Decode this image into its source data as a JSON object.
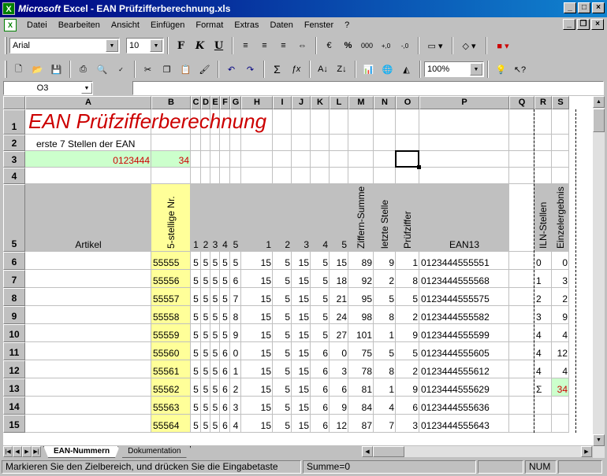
{
  "window": {
    "app_title_italic": "Microsoft",
    "app_title_rest": " Excel - EAN Prüfzifferberechnung.xls"
  },
  "menu": [
    "Datei",
    "Bearbeiten",
    "Ansicht",
    "Einfügen",
    "Format",
    "Extras",
    "Daten",
    "Fenster",
    "?"
  ],
  "toolbar": {
    "font": "Arial",
    "size": "10",
    "bold": "F",
    "italic": "K",
    "underline": "U",
    "zoom": "100%"
  },
  "formula_bar": {
    "name_box": "O3",
    "formula": ""
  },
  "columns": [
    "A",
    "B",
    "C",
    "D",
    "E",
    "F",
    "G",
    "H",
    "I",
    "J",
    "K",
    "L",
    "M",
    "N",
    "O",
    "P",
    "Q",
    "R",
    "S"
  ],
  "rows": [
    "1",
    "2",
    "3",
    "4",
    "5",
    "6",
    "7",
    "8",
    "9",
    "10",
    "11",
    "12",
    "13",
    "14",
    "15"
  ],
  "sheet": {
    "title": "EAN Prüfzifferberechnung",
    "label_first7": "erste 7 Stellen der EAN",
    "ean_prefix": "0123444",
    "result_b3": "34",
    "header": {
      "artikel": "Artikel",
      "nr": "5-stellige Nr.",
      "digit_labels": [
        "1",
        "2",
        "3",
        "4",
        "5"
      ],
      "weighted_labels": [
        "1",
        "2",
        "3",
        "4",
        "5"
      ],
      "ziffern_summe": "Ziffern-Summe",
      "letzte_stelle": "letzte Stelle",
      "pruefziffer": "Prüfziffer",
      "ean13": "EAN13",
      "iln_stellen": "ILN-Stellen",
      "einzelergebnis": "Einzelergebnis"
    },
    "data_rows": [
      {
        "nr": "55555",
        "d": [
          "5",
          "5",
          "5",
          "5",
          "5"
        ],
        "w": [
          "15",
          "5",
          "15",
          "5",
          "15"
        ],
        "sum": "89",
        "last": "9",
        "check": "1",
        "ean": "0123444555551",
        "r": "0",
        "s": "0"
      },
      {
        "nr": "55556",
        "d": [
          "5",
          "5",
          "5",
          "5",
          "6"
        ],
        "w": [
          "15",
          "5",
          "15",
          "5",
          "18"
        ],
        "sum": "92",
        "last": "2",
        "check": "8",
        "ean": "0123444555568",
        "r": "1",
        "s": "3"
      },
      {
        "nr": "55557",
        "d": [
          "5",
          "5",
          "5",
          "5",
          "7"
        ],
        "w": [
          "15",
          "5",
          "15",
          "5",
          "21"
        ],
        "sum": "95",
        "last": "5",
        "check": "5",
        "ean": "0123444555575",
        "r": "2",
        "s": "2"
      },
      {
        "nr": "55558",
        "d": [
          "5",
          "5",
          "5",
          "5",
          "8"
        ],
        "w": [
          "15",
          "5",
          "15",
          "5",
          "24"
        ],
        "sum": "98",
        "last": "8",
        "check": "2",
        "ean": "0123444555582",
        "r": "3",
        "s": "9"
      },
      {
        "nr": "55559",
        "d": [
          "5",
          "5",
          "5",
          "5",
          "9"
        ],
        "w": [
          "15",
          "5",
          "15",
          "5",
          "27"
        ],
        "sum": "101",
        "last": "1",
        "check": "9",
        "ean": "0123444555599",
        "r": "4",
        "s": "4"
      },
      {
        "nr": "55560",
        "d": [
          "5",
          "5",
          "5",
          "6",
          "0"
        ],
        "w": [
          "15",
          "5",
          "15",
          "6",
          "0"
        ],
        "sum": "75",
        "last": "5",
        "check": "5",
        "ean": "0123444555605",
        "r": "4",
        "s": "12"
      },
      {
        "nr": "55561",
        "d": [
          "5",
          "5",
          "5",
          "6",
          "1"
        ],
        "w": [
          "15",
          "5",
          "15",
          "6",
          "3"
        ],
        "sum": "78",
        "last": "8",
        "check": "2",
        "ean": "0123444555612",
        "r": "4",
        "s": "4"
      },
      {
        "nr": "55562",
        "d": [
          "5",
          "5",
          "5",
          "6",
          "2"
        ],
        "w": [
          "15",
          "5",
          "15",
          "6",
          "6"
        ],
        "sum": "81",
        "last": "1",
        "check": "9",
        "ean": "0123444555629",
        "r": "Σ",
        "s": "34"
      },
      {
        "nr": "55563",
        "d": [
          "5",
          "5",
          "5",
          "6",
          "3"
        ],
        "w": [
          "15",
          "5",
          "15",
          "6",
          "9"
        ],
        "sum": "84",
        "last": "4",
        "check": "6",
        "ean": "0123444555636",
        "r": "",
        "s": ""
      },
      {
        "nr": "55564",
        "d": [
          "5",
          "5",
          "5",
          "6",
          "4"
        ],
        "w": [
          "15",
          "5",
          "15",
          "6",
          "12"
        ],
        "sum": "87",
        "last": "7",
        "check": "3",
        "ean": "0123444555643",
        "r": "",
        "s": ""
      }
    ]
  },
  "tabs": [
    "EAN-Nummern",
    "Dokumentation"
  ],
  "status": {
    "message": "Markieren Sie den Zielbereich, und drücken Sie die Eingabetaste",
    "sum": "Summe=0",
    "num": "NUM"
  }
}
